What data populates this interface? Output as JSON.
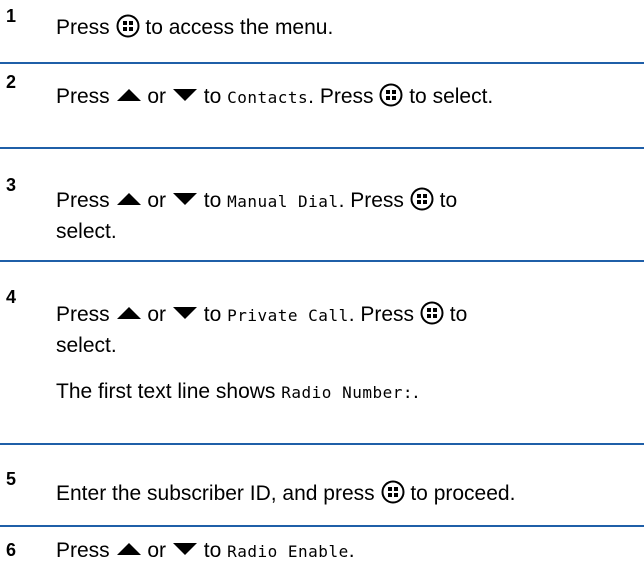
{
  "steps": [
    {
      "number": "1",
      "press": "Press",
      "suffix": "to access the menu."
    },
    {
      "number": "2",
      "press": "Press",
      "or": "or",
      "to": "to",
      "menu_item": "Contacts",
      "press_again": ". Press",
      "suffix": "to select."
    },
    {
      "number": "3",
      "press": "Press",
      "or": "or",
      "to": "to",
      "menu_item": "Manual Dial",
      "press_again": ". Press",
      "suffix": "to",
      "suffix_line2": "select."
    },
    {
      "number": "4",
      "press": "Press",
      "or": "or",
      "to": "to",
      "menu_item": "Private Call",
      "press_again": ". Press",
      "suffix": "to",
      "suffix_line2": "select.",
      "result_prefix": "The first text line shows",
      "result_mono": "Radio Number:",
      "result_suffix": "."
    },
    {
      "number": "5",
      "prefix": "Enter the subscriber ID, and press",
      "suffix": "to proceed."
    },
    {
      "number": "6",
      "press": "Press",
      "or": "or",
      "to": "to",
      "menu_item": "Radio Enable",
      "suffix": "."
    }
  ],
  "icons": {
    "menu_ok": "menu-ok-button-icon",
    "up": "up-arrow-icon",
    "down": "down-arrow-icon"
  },
  "colors": {
    "divider": "#1f5fa8",
    "text": "#000000"
  }
}
